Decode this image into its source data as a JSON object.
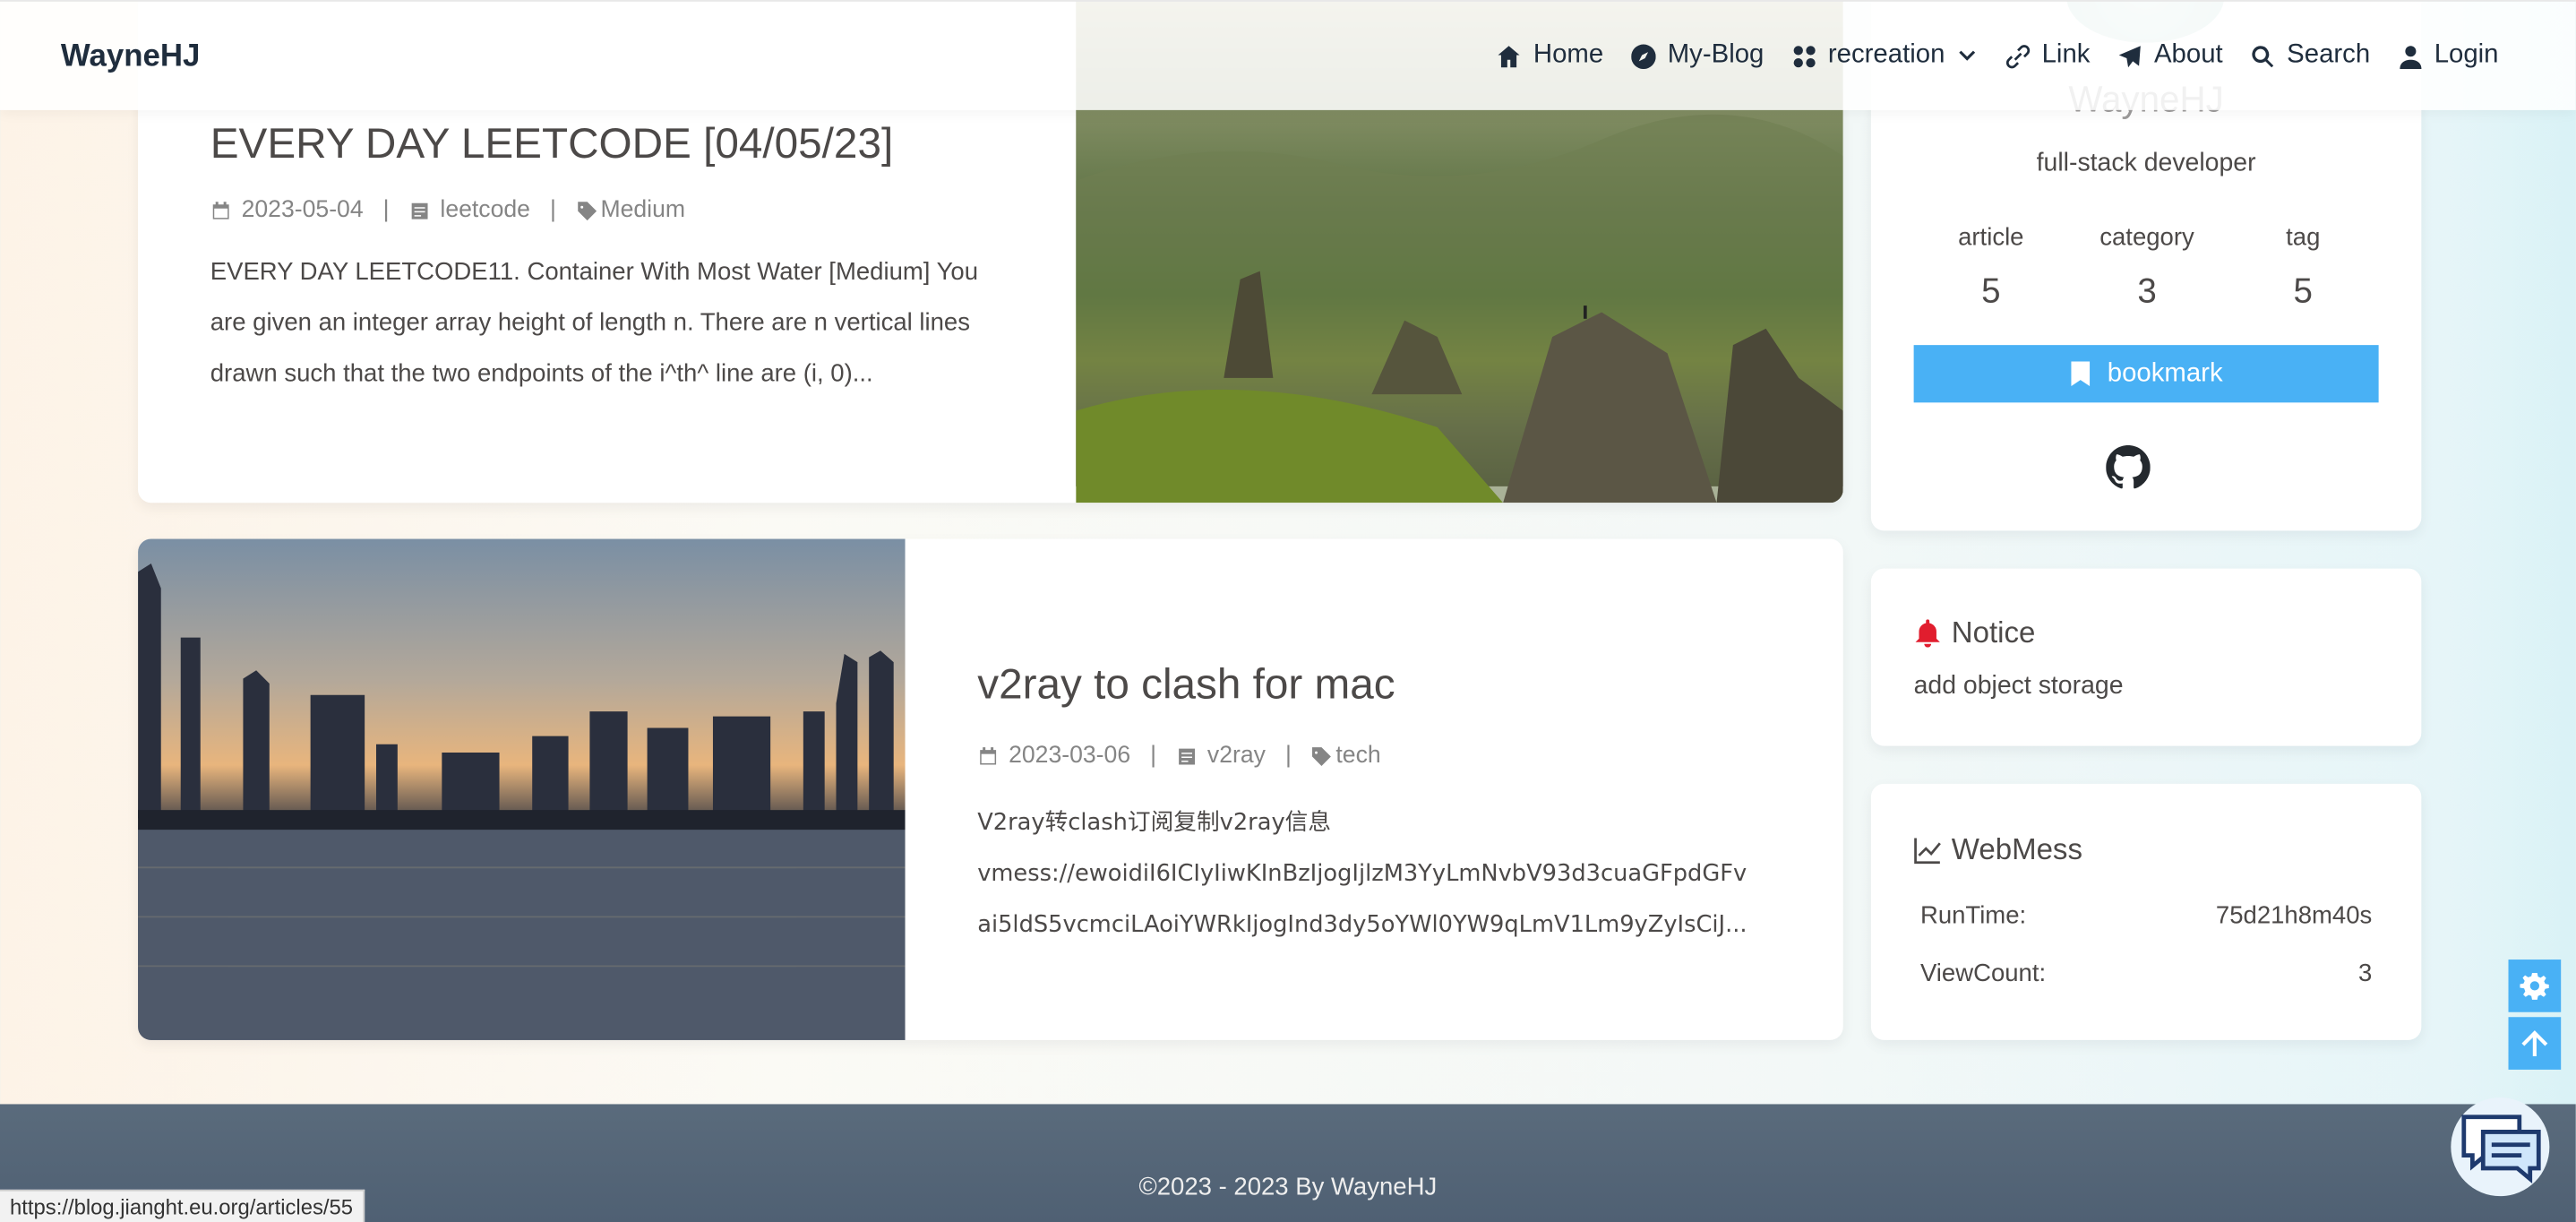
{
  "header": {
    "brand": "WayneHJ",
    "nav": [
      {
        "label": "Home",
        "icon": "home-icon"
      },
      {
        "label": "My-Blog",
        "icon": "compass-icon"
      },
      {
        "label": "recreation",
        "icon": "grid-icon",
        "dropdown": true
      },
      {
        "label": "Link",
        "icon": "link-icon"
      },
      {
        "label": "About",
        "icon": "paper-plane-icon"
      },
      {
        "label": "Search",
        "icon": "search-icon"
      },
      {
        "label": "Login",
        "icon": "user-icon"
      }
    ]
  },
  "posts": [
    {
      "title": "EVERY DAY LEETCODE [04/05/23]",
      "date": "2023-05-04",
      "category": "leetcode",
      "tag": "Medium",
      "excerpt": "EVERY DAY LEETCODE11. Container With Most Water [Medium] You are given an integer array height of length n. There are n vertical lines drawn such that the two endpoints of the i^th^ line are (i, 0)..."
    },
    {
      "title": "v2ray to clash for mac",
      "date": "2023-03-06",
      "category": "v2ray",
      "tag": "tech",
      "excerpt_line1": "V2ray转clash订阅复制v2ray信息",
      "excerpt_line2": "vmess://ewoidiI6ICIyIiwKInBzIjogIjlzM3YyLmNvbV93d3cuaGFpdGFv",
      "excerpt_line3": "ai5ldS5vcmciLAoiYWRkIjogInd3dy5oYWl0YW9qLmV1Lm9yZyIsCiJ..."
    }
  ],
  "profile": {
    "name": "WayneHJ",
    "description": "full-stack developer",
    "stats": [
      {
        "label": "article",
        "value": "5"
      },
      {
        "label": "category",
        "value": "3"
      },
      {
        "label": "tag",
        "value": "5"
      }
    ],
    "bookmark_label": "bookmark"
  },
  "notice": {
    "title": "Notice",
    "text": "add object storage"
  },
  "webmess": {
    "title": "WebMess",
    "runtime_label": "RunTime:",
    "runtime_value": "75d21h8m40s",
    "viewcount_label": "ViewCount:",
    "viewcount_value": "3"
  },
  "footer": {
    "copyright": "©2023 - 2023 By WayneHJ"
  },
  "status_url": "https://blog.jianght.eu.org/articles/55",
  "colors": {
    "accent": "#49b1f5",
    "footer": "#556677",
    "bell": "#e11d2e"
  }
}
